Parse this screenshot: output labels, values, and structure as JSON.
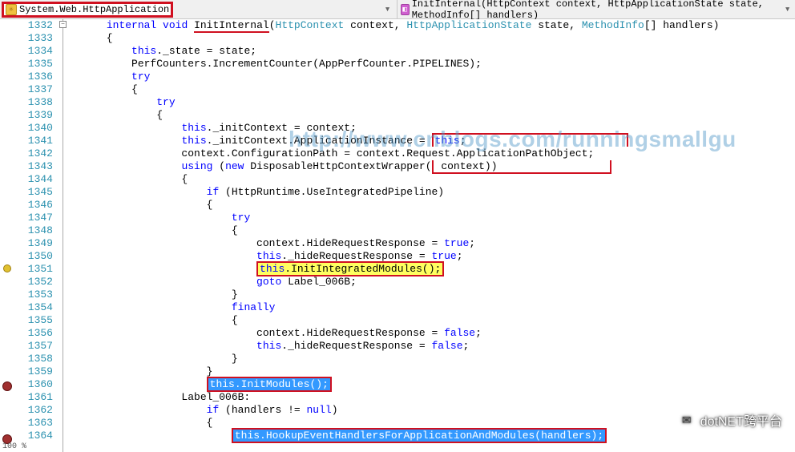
{
  "nav": {
    "class_label": "System.Web.HttpApplication",
    "method_label": "InitInternal(HttpContext context, HttpApplicationState state, MethodInfo[] handlers)",
    "dd_glyph": "▾"
  },
  "gutter": {
    "start": 1332,
    "end": 1364
  },
  "code": {
    "l1332": {
      "pre": "      ",
      "kw1": "internal",
      "sp1": " ",
      "kw2": "void",
      "sp2": " ",
      "name": "InitInternal",
      "sig1": "(",
      "t1": "HttpContext",
      "p1": " context, ",
      "t2": "HttpApplicationState",
      "p2": " state, ",
      "t3": "MethodInfo",
      "p3": "[] handlers)"
    },
    "l1333": "      {",
    "l1334": {
      "pre": "          ",
      "kw": "this",
      "rest": "._state = state;"
    },
    "l1335": "          PerfCounters.IncrementCounter(AppPerfCounter.PIPELINES);",
    "l1336": {
      "pre": "          ",
      "kw": "try"
    },
    "l1337": "          {",
    "l1338": {
      "pre": "              ",
      "kw": "try"
    },
    "l1339": "              {",
    "l1340": {
      "pre": "                  ",
      "kw": "this",
      "rest": "._initContext = context;"
    },
    "l1341": {
      "pre": "                  ",
      "kw1": "this",
      "mid": "._initContext.ApplicationInstance = ",
      "kw2": "this",
      "end": ";"
    },
    "l1342": "                  context.ConfigurationPath = context.Request.ApplicationPathObject;",
    "l1343": {
      "pre": "                  ",
      "kw1": "using",
      "sp": " (",
      "kw2": "new",
      "rest": " DisposableHttpContextWrapper(context))"
    },
    "l1344": "                  {",
    "l1345": {
      "pre": "                      ",
      "kw": "if",
      "rest": " (HttpRuntime.UseIntegratedPipeline)"
    },
    "l1346": "                      {",
    "l1347": {
      "pre": "                          ",
      "kw": "try"
    },
    "l1348": "                          {",
    "l1349": {
      "pre": "                              context.HideRequestResponse = ",
      "kw": "true",
      "end": ";"
    },
    "l1350": {
      "pre": "                              ",
      "kw1": "this",
      "mid": "._hideRequestResponse = ",
      "kw2": "true",
      "end": ";"
    },
    "l1351": {
      "pre": "                              ",
      "kw": "this",
      "rest": ".InitIntegratedModules();"
    },
    "l1352": {
      "pre": "                              ",
      "kw": "goto",
      "rest": " Label_006B;"
    },
    "l1353": "                          }",
    "l1354": {
      "pre": "                          ",
      "kw": "finally"
    },
    "l1355": "                          {",
    "l1356": {
      "pre": "                              context.HideRequestResponse = ",
      "kw": "false",
      "end": ";"
    },
    "l1357": {
      "pre": "                              ",
      "kw1": "this",
      "mid": "._hideRequestResponse = ",
      "kw2": "false",
      "end": ";"
    },
    "l1358": "                          }",
    "l1359": "                      }",
    "l1360": {
      "pre": "                      ",
      "kw": "this",
      "rest": ".InitModules();"
    },
    "l1361": "                  Label_006B:",
    "l1362": {
      "pre": "                      ",
      "kw1": "if",
      "mid": " (handlers != ",
      "kw2": "null",
      "end": ")"
    },
    "l1363": "                      {",
    "l1364": {
      "pre": "                          ",
      "kw": "this",
      "rest": ".HookupEventHandlersForApplicationAndModules(handlers);"
    }
  },
  "watermark": "http://www.cnblogs.com/runningsmallgu",
  "footer_brand": "dotNET跨平台",
  "bottom_status": "100 %",
  "icons": {
    "class_glyph": "⚛",
    "method_glyph": "◧",
    "fold_minus": "−",
    "wechat": "✉"
  }
}
